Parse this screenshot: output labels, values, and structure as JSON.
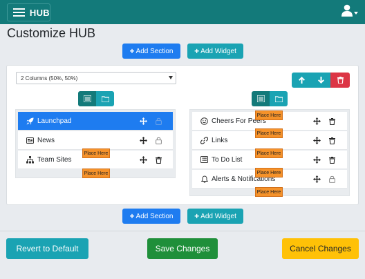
{
  "header": {
    "brand": "HUB"
  },
  "page": {
    "title": "Customize HUB"
  },
  "actions": {
    "add_section": "Add Section",
    "add_widget": "Add Widget"
  },
  "layout_select": {
    "value": "2 Columns (50%, 50%)"
  },
  "placeholder_label": "Place Here",
  "left_column": {
    "items": [
      {
        "label": "Launchpad",
        "icon": "rocket-icon"
      },
      {
        "label": "News",
        "icon": "newspaper-icon"
      },
      {
        "label": "Team Sites",
        "icon": "sitemap-icon"
      }
    ]
  },
  "right_column": {
    "items": [
      {
        "label": "Cheers For Peers",
        "icon": "smile-icon"
      },
      {
        "label": "Links",
        "icon": "link-icon"
      },
      {
        "label": "To Do List",
        "icon": "list-icon"
      },
      {
        "label": "Alerts & Notifications",
        "icon": "bell-icon"
      }
    ]
  },
  "footer": {
    "revert": "Revert to Default",
    "save": "Save Changes",
    "cancel": "Cancel Changes"
  },
  "colors": {
    "header": "#137a7a",
    "primary": "#1e7cf0",
    "info": "#1aa3b3",
    "success": "#1f8f3a",
    "warning": "#ffc107",
    "danger": "#dc3545",
    "placeholder": "#f5922a"
  }
}
